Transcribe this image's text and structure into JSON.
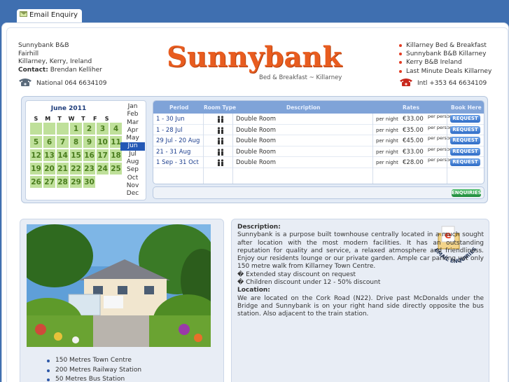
{
  "tab": {
    "label": "Email Enquiry"
  },
  "address": {
    "name": "Sunnybank B&B",
    "line1": "Fairhill",
    "line2": "Killarney, Kerry, Ireland",
    "contact_label": "Contact:",
    "contact_name": "Brendan Kelliher",
    "phone": "National 064 6634109"
  },
  "logo": {
    "title": "Sunnybank",
    "tagline": "Bed & Breakfast ~ Killarney"
  },
  "links": [
    "Killarney Bed & Breakfast",
    "Sunnybank B&B Killarney",
    "Kerry B&B Ireland",
    "Last Minute Deals Killarney"
  ],
  "phone_intl": "Intl +353 64 6634109",
  "calendar": {
    "title": "June 2011",
    "dow": [
      "S",
      "M",
      "T",
      "W",
      "T",
      "F",
      "S"
    ],
    "weeks": [
      [
        "",
        "",
        "",
        "1",
        "2",
        "3",
        "4"
      ],
      [
        "5",
        "6",
        "7",
        "8",
        "9",
        "10",
        "11"
      ],
      [
        "12",
        "13",
        "14",
        "15",
        "16",
        "17",
        "18"
      ],
      [
        "19",
        "20",
        "21",
        "22",
        "23",
        "24",
        "25"
      ],
      [
        "26",
        "27",
        "28",
        "29",
        "30",
        "",
        ""
      ]
    ],
    "months": [
      "Jan",
      "Feb",
      "Mar",
      "Apr",
      "May",
      "Jun",
      "Jul",
      "Aug",
      "Sep",
      "Oct",
      "Nov",
      "Dec"
    ],
    "selected_month": "Jun"
  },
  "rates": {
    "headers": {
      "period": "Period",
      "room_type": "Room Type",
      "description": "Description",
      "rates": "Rates",
      "book": "Book Here"
    },
    "rows": [
      {
        "period": "1 - 30 Jun",
        "description": "Double Room",
        "per_night": "per night",
        "price": "€33.00",
        "per_person": "per person",
        "request": "REQUEST"
      },
      {
        "period": "1 - 28 Jul",
        "description": "Double Room",
        "per_night": "per night",
        "price": "€35.00",
        "per_person": "per person",
        "request": "REQUEST"
      },
      {
        "period": "29 Jul - 20 Aug",
        "description": "Double Room",
        "per_night": "per night",
        "price": "€45.00",
        "per_person": "per person",
        "request": "REQUEST"
      },
      {
        "period": "21 - 31 Aug",
        "description": "Double Room",
        "per_night": "per night",
        "price": "€33.00",
        "per_person": "per person",
        "request": "REQUEST"
      },
      {
        "period": "1 Sep - 31 Oct",
        "description": "Double Room",
        "per_night": "per night",
        "price": "€28.00",
        "per_person": "per person",
        "request": "REQUEST"
      }
    ],
    "enquiries": "ENQUIRIES"
  },
  "features": [
    "150 Metres Town Centre",
    "200 Metres Railway Station",
    "50 Metres Bus Station"
  ],
  "description": {
    "heading": "Description:",
    "body": "Sunnybank is a purpose built townhouse centrally located in a much sought after location with the most modern facilities. It has an outstanding reputation for quality and service, a relaxed atmosphere and friendliness. Enjoy our residents lounge or our private garden. Ample car parking yet only 150 metre walk from Killarney Town Centre.",
    "bullet1": "� Extended stay discount on request",
    "bullet2": "� Children discount under 12 - 50% discount",
    "location_heading": "Location:",
    "location_body": "We are located on the Cork Road (N22). Drive past McDonalds under the Bridge and Sunnybank is on your right hand side directly opposite the bus station. Also adjacent to the train station.",
    "badge_letter": "e",
    "badge_text": "EMAIL ENQUIRIES"
  },
  "colors": {
    "background": "#3f6fb0",
    "logo": "#e85c1f",
    "calendar_day": "#bfe09a",
    "rates_header": "#7fa3d8"
  }
}
